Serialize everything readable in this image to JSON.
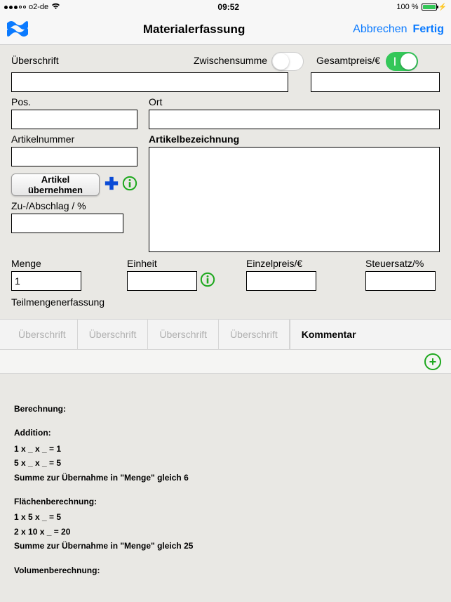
{
  "status": {
    "carrier": "o2-de",
    "time": "09:52",
    "battery_pct": "100 %"
  },
  "nav": {
    "title": "Materialerfassung",
    "cancel": "Abbrechen",
    "done": "Fertig"
  },
  "labels": {
    "ueberschrift": "Überschrift",
    "zwischensumme": "Zwischensumme",
    "gesamtpreis": "Gesamtpreis/€",
    "pos": "Pos.",
    "ort": "Ort",
    "artikelnummer": "Artikelnummer",
    "artikelbezeichnung": "Artikelbezeichnung",
    "artikel_uebernehmen": "Artikel übernehmen",
    "zuabschlag": "Zu-/Abschlag / %",
    "menge": "Menge",
    "einheit": "Einheit",
    "einzelpreis": "Einzelpreis/€",
    "steuersatz": "Steuersatz/%",
    "teilmengen": "Teilmengenerfassung"
  },
  "values": {
    "ueberschrift": "",
    "gesamtpreis": "",
    "pos": "",
    "ort": "",
    "artikelnummer": "",
    "artikelbezeichnung": "",
    "zuabschlag": "",
    "menge": "1",
    "einheit": "",
    "einzelpreis": "",
    "steuersatz": ""
  },
  "switches": {
    "zwischensumme": false,
    "gesamtpreis": true
  },
  "tabs": {
    "items": [
      "Überschrift",
      "Überschrift",
      "Überschrift",
      "Überschrift",
      "Kommentar"
    ],
    "active_index": 4
  },
  "calc": {
    "title": "Berechnung:",
    "sec1": "Addition:",
    "l1": "1 x _ x _ = 1",
    "l2": "5 x _ x _ = 5",
    "l3": "Summe zur Übernahme in \"Menge\" gleich 6",
    "sec2": "Flächenberechnung:",
    "l4": "1 x 5 x _ = 5",
    "l5": "2 x 10 x _ = 20",
    "l6": "Summe zur Übernahme in \"Menge\" gleich 25",
    "sec3": "Volumenberechnung:"
  }
}
